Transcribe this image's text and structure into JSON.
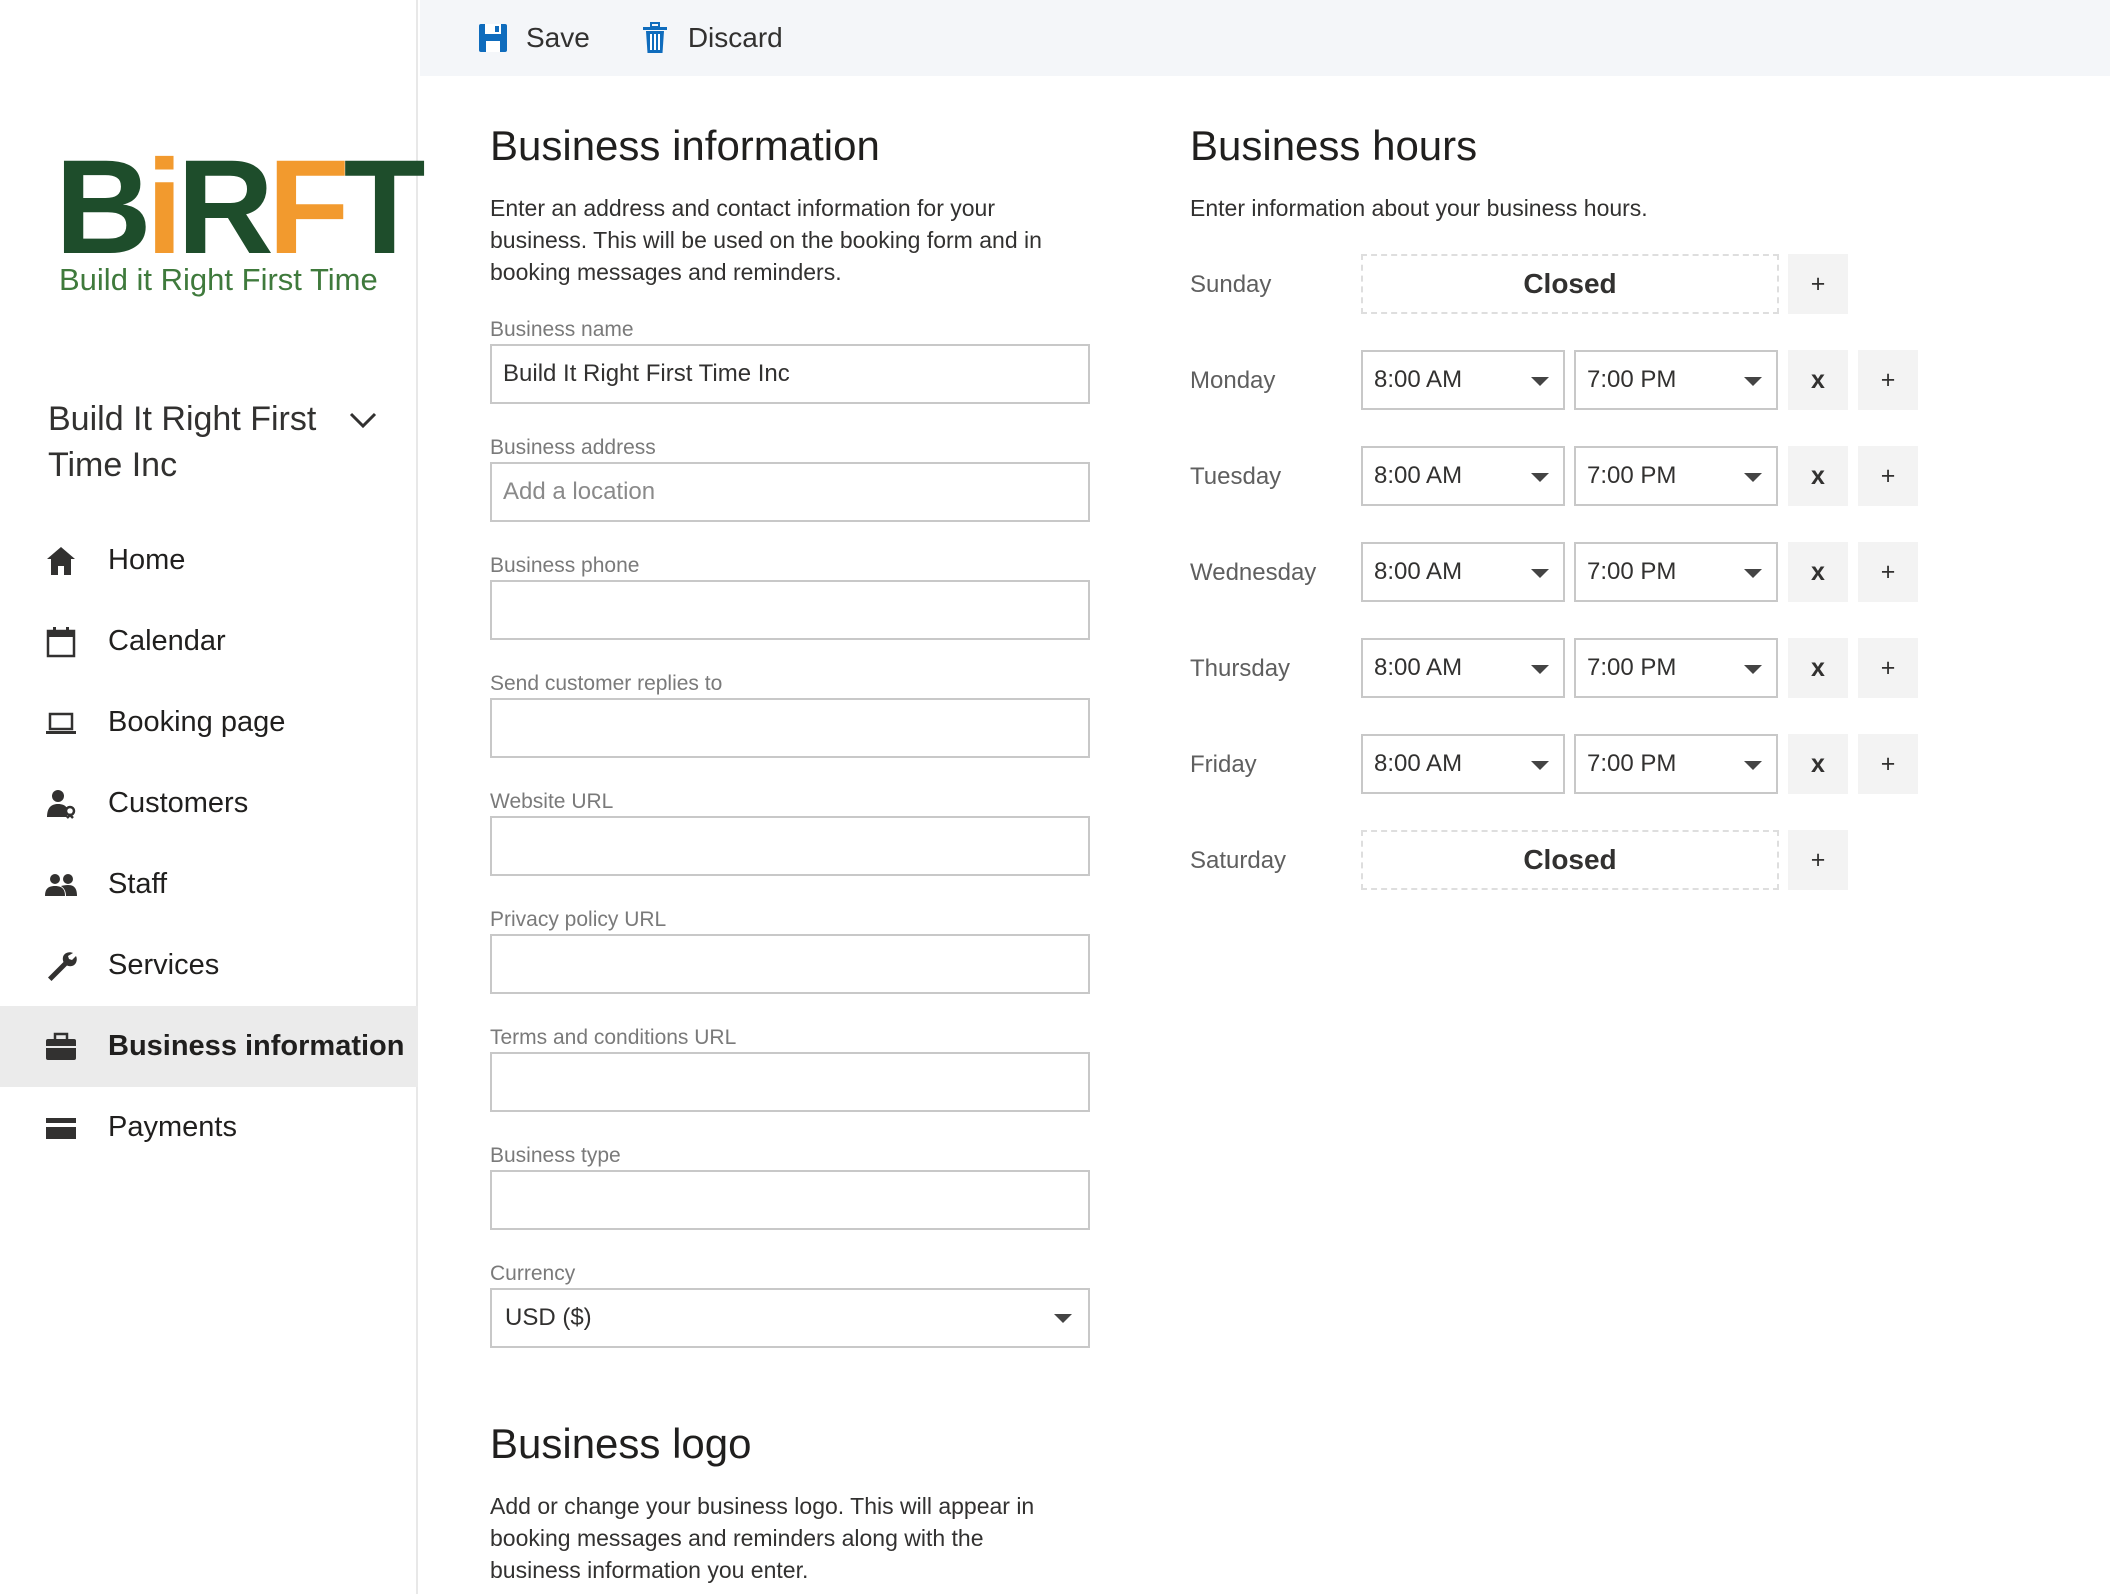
{
  "toolbar": {
    "save_label": "Save",
    "discard_label": "Discard"
  },
  "sidebar": {
    "logo": {
      "word_green_1": "B",
      "word_orange_1": "i",
      "word_green_2": "R",
      "word_orange_2": "F",
      "word_green_3": "T",
      "tagline": "Build it Right First Time"
    },
    "org_name": "Build It Right First Time Inc",
    "nav": [
      {
        "label": "Home",
        "icon": "home-icon"
      },
      {
        "label": "Calendar",
        "icon": "calendar-icon"
      },
      {
        "label": "Booking page",
        "icon": "laptop-icon"
      },
      {
        "label": "Customers",
        "icon": "customer-icon"
      },
      {
        "label": "Staff",
        "icon": "staff-icon"
      },
      {
        "label": "Services",
        "icon": "wrench-icon"
      },
      {
        "label": "Business information",
        "icon": "briefcase-icon",
        "active": true
      },
      {
        "label": "Payments",
        "icon": "credit-card-icon"
      }
    ]
  },
  "business_info": {
    "title": "Business information",
    "description": "Enter an address and contact information for your business. This will be used on the booking form and in booking messages and reminders.",
    "fields": {
      "name": {
        "label": "Business name",
        "value": "Build It Right First Time Inc",
        "placeholder": ""
      },
      "address": {
        "label": "Business address",
        "value": "",
        "placeholder": "Add a location"
      },
      "phone": {
        "label": "Business phone",
        "value": "",
        "placeholder": ""
      },
      "replies": {
        "label": "Send customer replies to",
        "value": "",
        "placeholder": ""
      },
      "website": {
        "label": "Website URL",
        "value": "",
        "placeholder": ""
      },
      "privacy": {
        "label": "Privacy policy URL",
        "value": "",
        "placeholder": ""
      },
      "terms": {
        "label": "Terms and conditions URL",
        "value": "",
        "placeholder": ""
      },
      "type": {
        "label": "Business type",
        "value": "",
        "placeholder": ""
      },
      "currency": {
        "label": "Currency",
        "value": "USD ($)"
      }
    }
  },
  "business_logo": {
    "title": "Business logo",
    "description": "Add or change your business logo. This will appear in booking messages and reminders along with the business information you enter."
  },
  "business_hours": {
    "title": "Business hours",
    "description": "Enter information about your business hours.",
    "closed_label": "Closed",
    "remove_label": "x",
    "add_label": "+",
    "days": [
      {
        "day": "Sunday",
        "closed": true
      },
      {
        "day": "Monday",
        "open": "8:00 AM",
        "close": "7:00 PM"
      },
      {
        "day": "Tuesday",
        "open": "8:00 AM",
        "close": "7:00 PM"
      },
      {
        "day": "Wednesday",
        "open": "8:00 AM",
        "close": "7:00 PM"
      },
      {
        "day": "Thursday",
        "open": "8:00 AM",
        "close": "7:00 PM"
      },
      {
        "day": "Friday",
        "open": "8:00 AM",
        "close": "7:00 PM"
      },
      {
        "day": "Saturday",
        "closed": true
      }
    ]
  },
  "colors": {
    "accent_blue": "#0f6cbd",
    "logo_green": "#1e4d2b",
    "logo_orange": "#f29a2e",
    "active_nav_bg": "#ebebeb",
    "toolbar_bg": "#f4f6f9"
  }
}
